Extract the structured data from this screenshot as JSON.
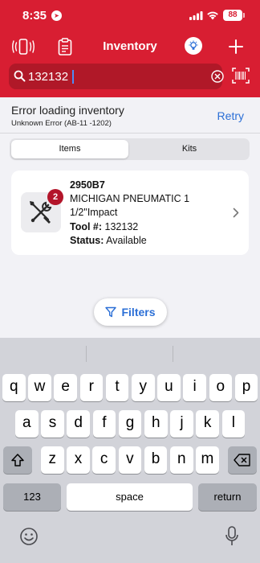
{
  "status_bar": {
    "time": "8:35",
    "battery": "88"
  },
  "nav": {
    "title": "Inventory"
  },
  "search": {
    "value": "132132",
    "placeholder": ""
  },
  "error": {
    "title": "Error loading inventory",
    "detail": "Unknown Error (AB-11 -1202)",
    "retry_label": "Retry"
  },
  "segments": [
    {
      "label": "Items",
      "selected": true
    },
    {
      "label": "Kits",
      "selected": false
    }
  ],
  "result": {
    "title": "2950B7",
    "name_line1": "MICHIGAN PNEUMATIC  1",
    "name_line2": "1/2\"Impact",
    "tool_label": "Tool #:",
    "tool_number": "132132",
    "status_label": "Status:",
    "status_value": "Available",
    "badge_count": "2"
  },
  "filters_label": "Filters",
  "keyboard": {
    "row1": [
      "q",
      "w",
      "e",
      "r",
      "t",
      "y",
      "u",
      "i",
      "o",
      "p"
    ],
    "row2": [
      "a",
      "s",
      "d",
      "f",
      "g",
      "h",
      "j",
      "k",
      "l"
    ],
    "row3": [
      "z",
      "x",
      "c",
      "v",
      "b",
      "n",
      "m"
    ],
    "numbers_label": "123",
    "space_label": "space",
    "return_label": "return"
  },
  "colors": {
    "brand_red": "#d81e32",
    "link_blue": "#2b6fd6",
    "badge_red": "#b3152a"
  }
}
